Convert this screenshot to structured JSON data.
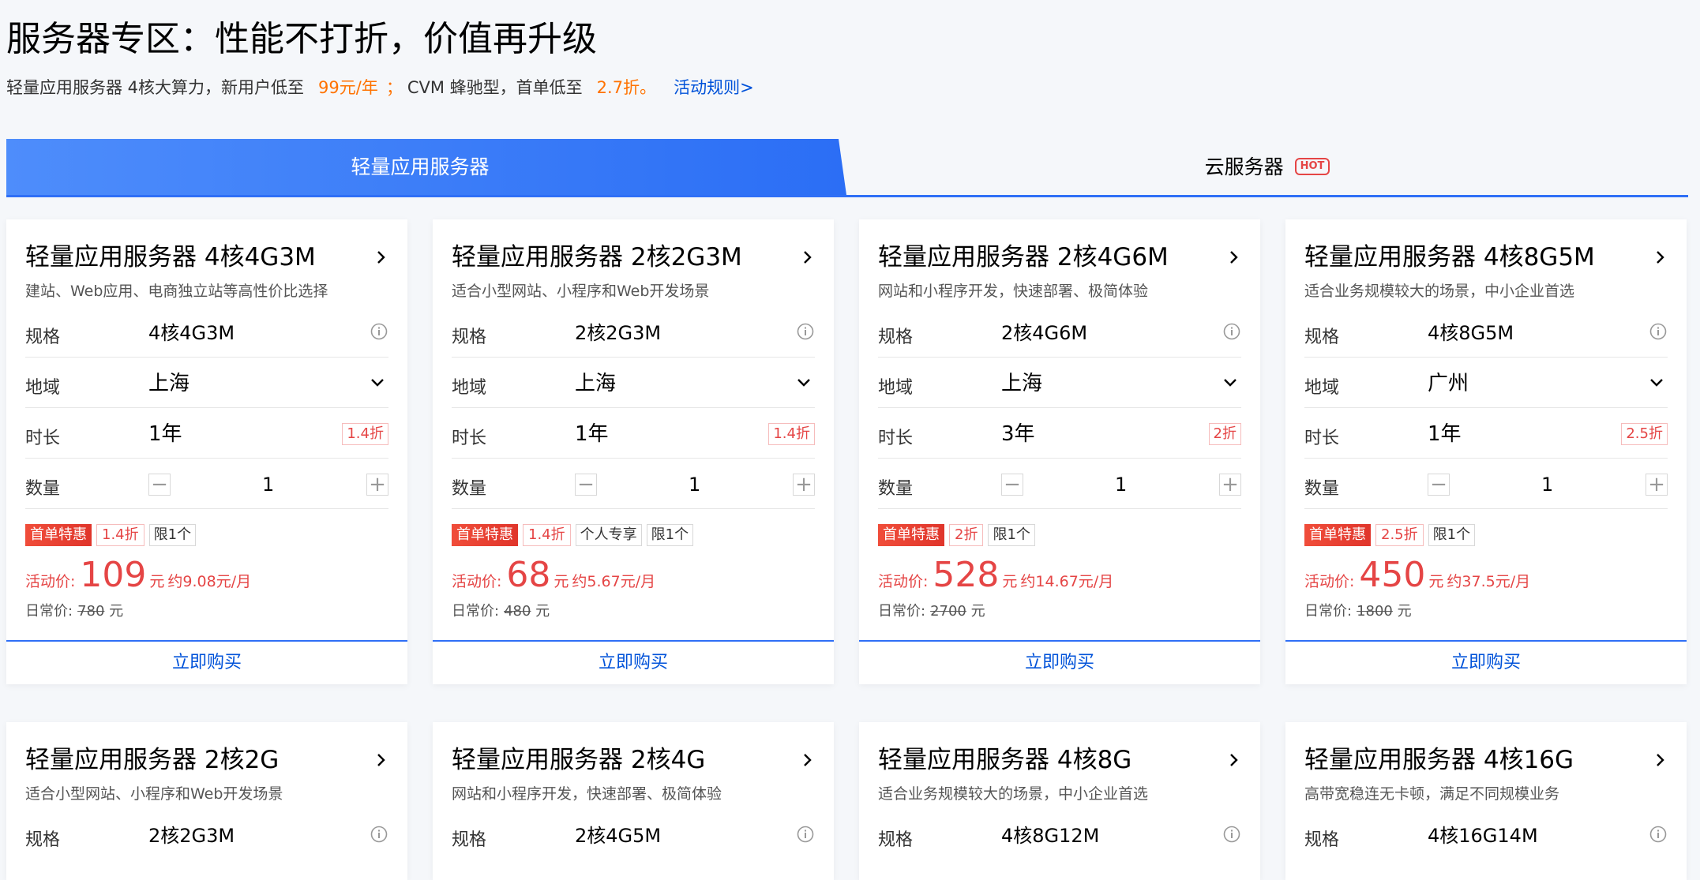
{
  "header": {
    "title": "服务器专区：性能不打折，价值再升级",
    "sub_a": "轻量应用服务器 4核大算力，新用户低至",
    "sub_price": "99元/年",
    "sub_semicolon": "；",
    "sub_b": "CVM 蜂驰型，首单低至",
    "sub_discount": "2.7折。",
    "rules_link": "活动规则>"
  },
  "tabs": {
    "active": "轻量应用服务器",
    "inactive": "云服务器",
    "hot": "HOT"
  },
  "labels": {
    "spec": "规格",
    "region": "地域",
    "duration": "时长",
    "quantity": "数量",
    "price_label": "活动价:",
    "unit": "元",
    "orig_label": "日常价:",
    "buy": "立即购买",
    "minus": "−",
    "plus": "+"
  },
  "colors": {
    "accent": "#2f6ff6",
    "price_red": "#e54545",
    "orange": "#ff7200",
    "link": "#0052d9"
  },
  "cards_row1": [
    {
      "title": "轻量应用服务器 4核4G3M",
      "desc": "建站、Web应用、电商独立站等高性价比选择",
      "spec": "4核4G3M",
      "region": "上海",
      "duration": "1年",
      "duration_discount": "1.4折",
      "quantity": "1",
      "tag_first": "首单特惠",
      "tag_discount": "1.4折",
      "tag_extra": "",
      "tag_limit": "限1个",
      "price": "109",
      "monthly": "约9.08元/月",
      "orig_price": "780"
    },
    {
      "title": "轻量应用服务器 2核2G3M",
      "desc": "适合小型网站、小程序和Web开发场景",
      "spec": "2核2G3M",
      "region": "上海",
      "duration": "1年",
      "duration_discount": "1.4折",
      "quantity": "1",
      "tag_first": "首单特惠",
      "tag_discount": "1.4折",
      "tag_extra": "个人专享",
      "tag_limit": "限1个",
      "price": "68",
      "monthly": "约5.67元/月",
      "orig_price": "480"
    },
    {
      "title": "轻量应用服务器 2核4G6M",
      "desc": "网站和小程序开发，快速部署、极简体验",
      "spec": "2核4G6M",
      "region": "上海",
      "duration": "3年",
      "duration_discount": "2折",
      "quantity": "1",
      "tag_first": "首单特惠",
      "tag_discount": "2折",
      "tag_extra": "",
      "tag_limit": "限1个",
      "price": "528",
      "monthly": "约14.67元/月",
      "orig_price": "2700"
    },
    {
      "title": "轻量应用服务器 4核8G5M",
      "desc": "适合业务规模较大的场景，中小企业首选",
      "spec": "4核8G5M",
      "region": "广州",
      "duration": "1年",
      "duration_discount": "2.5折",
      "quantity": "1",
      "tag_first": "首单特惠",
      "tag_discount": "2.5折",
      "tag_extra": "",
      "tag_limit": "限1个",
      "price": "450",
      "monthly": "约37.5元/月",
      "orig_price": "1800"
    }
  ],
  "cards_row2": [
    {
      "title": "轻量应用服务器 2核2G",
      "desc": "适合小型网站、小程序和Web开发场景",
      "spec": "2核2G3M"
    },
    {
      "title": "轻量应用服务器 2核4G",
      "desc": "网站和小程序开发，快速部署、极简体验",
      "spec": "2核4G5M"
    },
    {
      "title": "轻量应用服务器 4核8G",
      "desc": "适合业务规模较大的场景，中小企业首选",
      "spec": "4核8G12M"
    },
    {
      "title": "轻量应用服务器 4核16G",
      "desc": "高带宽稳连无卡顿，满足不同规模业务",
      "spec": "4核16G14M"
    }
  ]
}
